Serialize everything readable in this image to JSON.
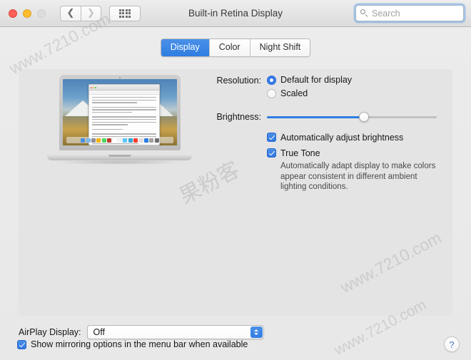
{
  "window": {
    "title": "Built-in Retina Display",
    "traffic_lights": [
      "close",
      "minimize",
      "zoom-disabled"
    ],
    "nav": {
      "back": "‹",
      "forward": "›",
      "grid": "show-all-grid"
    },
    "search": {
      "placeholder": "Search",
      "value": ""
    }
  },
  "tabs": [
    {
      "label": "Display",
      "selected": true
    },
    {
      "label": "Color",
      "selected": false
    },
    {
      "label": "Night Shift",
      "selected": false
    }
  ],
  "display": {
    "resolution_label": "Resolution:",
    "resolution_options": [
      {
        "label": "Default for display",
        "selected": true
      },
      {
        "label": "Scaled",
        "selected": false
      }
    ],
    "brightness_label": "Brightness:",
    "brightness_percent": 57,
    "auto_brightness": {
      "label": "Automatically adjust brightness",
      "checked": true
    },
    "true_tone": {
      "label": "True Tone",
      "checked": true
    },
    "true_tone_description": "Automatically adapt display to make colors appear consistent in different ambient lighting conditions."
  },
  "airplay": {
    "label": "AirPlay Display:",
    "value": "Off"
  },
  "mirroring": {
    "label": "Show mirroring options in the menu bar when available",
    "checked": true
  },
  "help": {
    "label": "?"
  },
  "watermarks": {
    "w1": "www.7210.com",
    "w2": "www.7210.com",
    "w3": "www.7210.com",
    "cn": "果粉客"
  },
  "colors": {
    "accent": "#2f7de1",
    "window_bg": "#ececec",
    "panel_bg": "#e4e4e4",
    "traffic_red": "#ff5f57",
    "traffic_yellow": "#ffbd2e",
    "traffic_gray": "#dcdcdc"
  }
}
